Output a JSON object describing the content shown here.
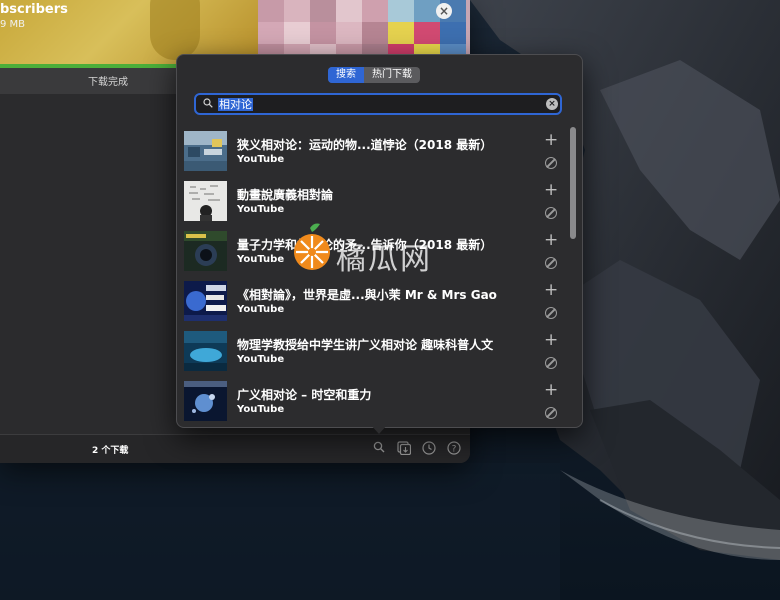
{
  "background_window": {
    "item_title": "bscribers",
    "item_size": "9 MB",
    "item_status": "下载完成",
    "download_count": "2 个下载",
    "footer_icons": [
      "search-icon",
      "batch-download-icon",
      "history-icon",
      "help-icon"
    ]
  },
  "popover": {
    "tabs": [
      {
        "label": "搜索",
        "active": true
      },
      {
        "label": "热门下载",
        "active": false
      }
    ],
    "search": {
      "value": "相对论"
    },
    "results": [
      {
        "title": "狭义相对论：运动的物...道悖论（2018 最新）",
        "source": "YouTube"
      },
      {
        "title": "動畫說廣義相對論",
        "source": "YouTube"
      },
      {
        "title": "量子力学和相对论的矛...告诉你（2018 最新）",
        "source": "YouTube"
      },
      {
        "title": "《相對論》，世界是虛...與小茉 Mr & Mrs Gao",
        "source": "YouTube"
      },
      {
        "title": "物理学教授给中学生讲广义相对论 趣味科普人文",
        "source": "YouTube"
      },
      {
        "title": "广义相对论 – 时空和重力",
        "source": "YouTube"
      }
    ],
    "row_actions": {
      "add": "+",
      "block": "block-icon"
    }
  },
  "watermark": {
    "text": "橘瓜网"
  },
  "colors": {
    "accent": "#2f66d4",
    "popover_bg": "#2c2c2e",
    "progress_green": "#4cae3a"
  }
}
